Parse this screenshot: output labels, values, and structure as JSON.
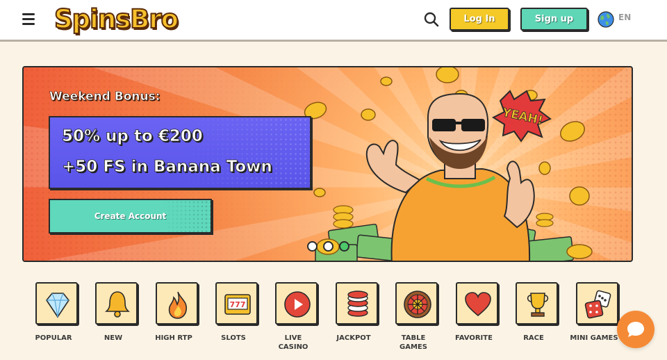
{
  "header": {
    "logo_text": "SpinsBro",
    "login_label": "Log In",
    "signup_label": "Sign up",
    "language": "EN"
  },
  "banner": {
    "title": "Weekend Bonus:",
    "offer_line1": "50% up to €200",
    "offer_line2": "+50 FS in Banana Town",
    "cta_label": "Create Account",
    "illustration_text": "YEAH!",
    "slides": 3,
    "active_slide": 3
  },
  "categories": [
    {
      "label": "POPULAR",
      "icon": "diamond-icon"
    },
    {
      "label": "NEW",
      "icon": "bell-icon"
    },
    {
      "label": "HIGH RTP",
      "icon": "flame-icon"
    },
    {
      "label": "SLOTS",
      "icon": "slot-machine-icon"
    },
    {
      "label": "LIVE\nCASINO",
      "icon": "play-icon"
    },
    {
      "label": "JACKPOT",
      "icon": "chips-icon"
    },
    {
      "label": "TABLE\nGAMES",
      "icon": "roulette-icon"
    },
    {
      "label": "FAVORITE",
      "icon": "heart-icon"
    },
    {
      "label": "RACE",
      "icon": "trophy-icon"
    },
    {
      "label": "MINI GAMES",
      "icon": "dice-icon"
    }
  ],
  "slot_text": "777",
  "colors": {
    "background": "#fbf4e6",
    "login": "#f4c928",
    "signup": "#5fd6b6",
    "offer_box": "#5a54ea",
    "chat": "#f58a36"
  }
}
